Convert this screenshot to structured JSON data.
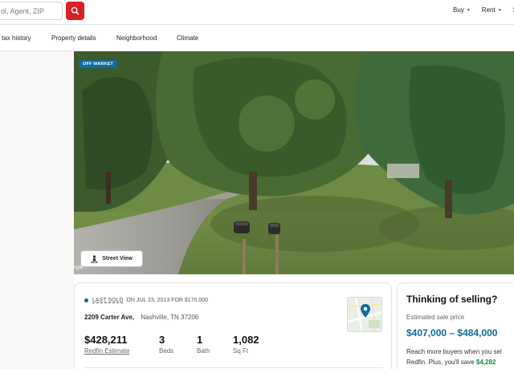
{
  "header": {
    "search_placeholder": "ol, Agent, ZIP",
    "nav": [
      {
        "label": "Buy"
      },
      {
        "label": "Rent"
      },
      {
        "label": "S"
      }
    ]
  },
  "tabs": [
    {
      "label": "tax history"
    },
    {
      "label": "Property details"
    },
    {
      "label": "Neighborhood"
    },
    {
      "label": "Climate"
    }
  ],
  "photo": {
    "badge": "OFF MARKET",
    "street_view_label": "Street View",
    "attribution": "ogle"
  },
  "property": {
    "status_label": "LAST SOLD",
    "status_detail": "ON JUL 23, 2013 FOR $170,000",
    "street": "2209 Carter Ave,",
    "city": "Nashville, TN 37206",
    "stats": [
      {
        "value": "$428,211",
        "label": "Redfin Estimate"
      },
      {
        "value": "3",
        "label": "Beds"
      },
      {
        "value": "1",
        "label": "Bath"
      },
      {
        "value": "1,082",
        "label": "Sq Ft"
      }
    ]
  },
  "selling": {
    "title": "Thinking of selling?",
    "subtitle": "Estimated sale price",
    "range": "$407,000 – $484,000",
    "body_line1": "Reach more buyers when you sel",
    "body_line2_prefix": "Redfin. Plus, you'll save ",
    "body_line2_amount": "$4,282"
  },
  "colors": {
    "brand_red": "#d92228",
    "accent_blue": "#0d6b9e",
    "savings_green": "#0f8a3c"
  }
}
